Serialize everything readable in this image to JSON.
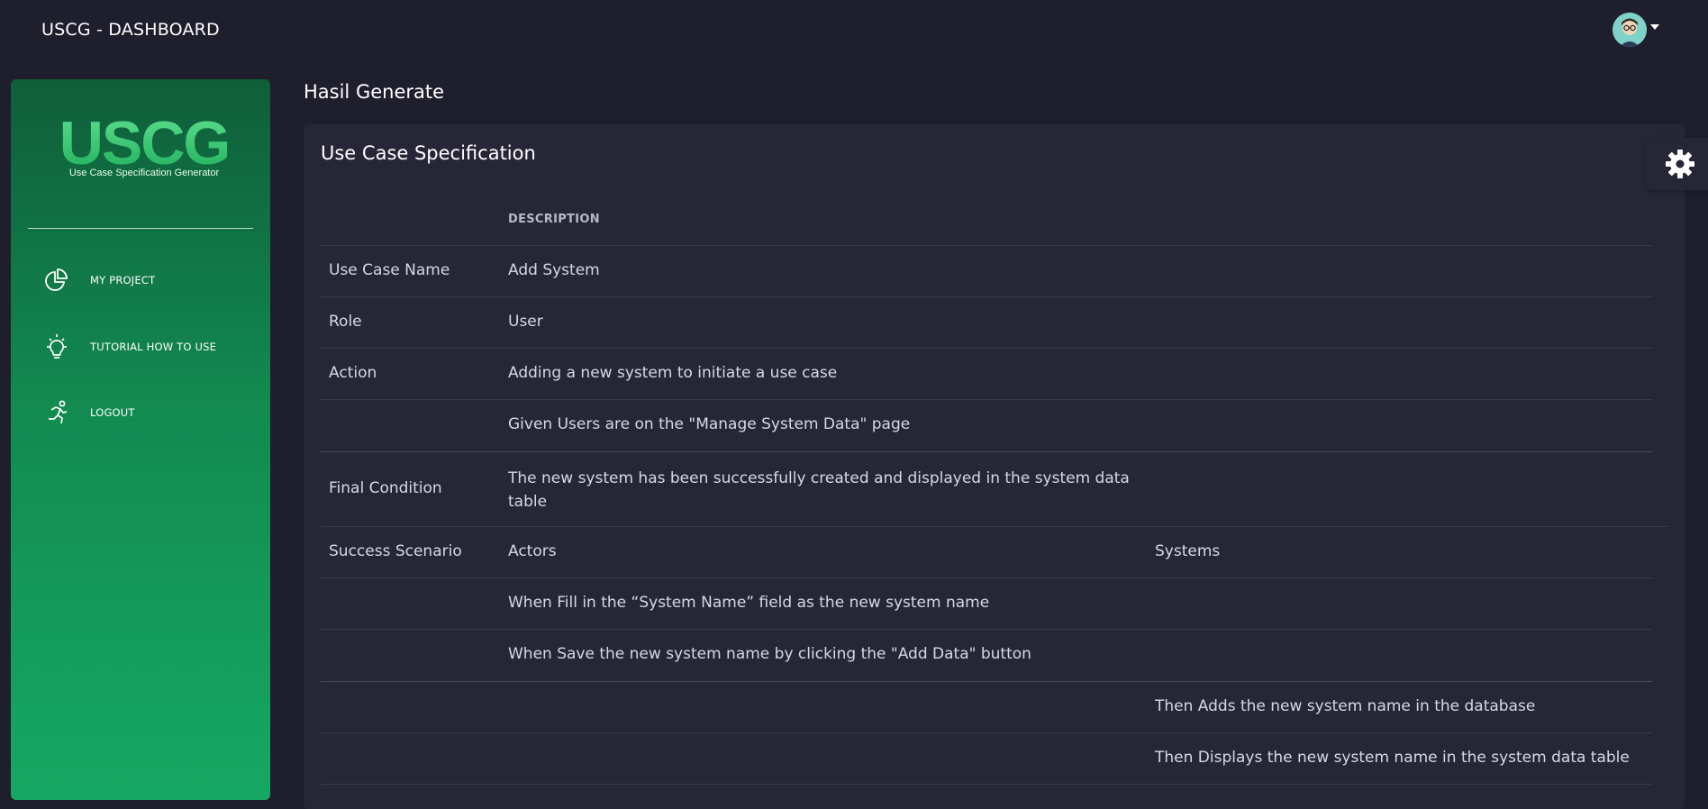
{
  "header": {
    "title": "USCG - DASHBOARD",
    "avatar_icon": "user-avatar"
  },
  "sidebar": {
    "logo_text": "USCG",
    "logo_subtitle": "Use Case Specification Generator",
    "items": [
      {
        "label": "MY PROJECT",
        "icon": "pie-chart-icon"
      },
      {
        "label": "TUTORIAL HOW TO USE",
        "icon": "lightbulb-icon"
      },
      {
        "label": "LOGOUT",
        "icon": "running-icon"
      }
    ]
  },
  "main": {
    "heading": "Hasil Generate",
    "card_title": "Use Case Specification",
    "table_header": {
      "description": "DESCRIPTION"
    },
    "rows": [
      {
        "label": "Use Case Name",
        "value": "Add System"
      },
      {
        "label": "Role",
        "value": "User"
      },
      {
        "label": "Action",
        "value": "Adding a new system to initiate a use case"
      },
      {
        "label": "",
        "value": "Given Users are on the \"Manage System Data\" page"
      },
      {
        "label": "Final Condition",
        "value": "The new system has been successfully created and displayed in the system data table"
      }
    ],
    "scenario": {
      "label": "Success Scenario",
      "actors_header": "Actors",
      "systems_header": "Systems",
      "actor_steps": [
        "When Fill in the “System Name” field as the new system name",
        "When Save the new system name by clicking the \"Add Data\" button"
      ],
      "system_steps": [
        "Then Adds the new system name in the database",
        "Then Displays the new system name in the system data table"
      ]
    }
  },
  "settings": {
    "icon": "gear-icon"
  },
  "colors": {
    "background": "#1e1e2d",
    "card": "#262637",
    "sidebar_top": "#0f5e3a",
    "sidebar_bottom": "#16a862",
    "logo_green": "#3fd07a"
  }
}
